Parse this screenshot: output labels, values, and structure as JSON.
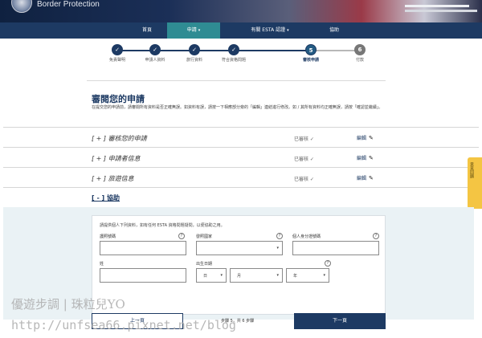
{
  "header": {
    "agency": "Border Protection"
  },
  "nav": {
    "items": [
      {
        "label": "首頁"
      },
      {
        "label": "申請",
        "caret": "▾"
      },
      {
        "label": "有關 ESTA 認證",
        "caret": "▾"
      },
      {
        "label": "協助"
      }
    ]
  },
  "progress": {
    "steps": [
      {
        "marker": "✓",
        "label": "免責聲明"
      },
      {
        "marker": "✓",
        "label": "申請人資料"
      },
      {
        "marker": "✓",
        "label": "旅行資料"
      },
      {
        "marker": "✓",
        "label": "符合資格問題"
      },
      {
        "marker": "5",
        "label": "審核申請"
      },
      {
        "marker": "6",
        "label": "付款"
      }
    ]
  },
  "main": {
    "title": "審閱您的申請",
    "intro": "在提交您的申請前，請審閱所有資料是否正確無誤。如資料有誤，請按一下相應部分旁的「編輯」連結進行修改。如 / 其所有資料均正確無誤，請按「確認並繼續」。"
  },
  "sections": [
    {
      "title": "[ + ] 審核您的申請",
      "status": "已審核 ✓",
      "edit": "編輯",
      "pencil": "✎"
    },
    {
      "title": "[ + ] 申請者信息",
      "status": "已審核 ✓",
      "edit": "編輯",
      "pencil": "✎"
    },
    {
      "title": "[ + ] 旅遊信息",
      "status": "已審核 ✓",
      "edit": "編輯",
      "pencil": "✎"
    }
  ],
  "help": {
    "label": "[ - ] 協助"
  },
  "side_tab": {
    "label": "意見回饋"
  },
  "form": {
    "hint": "請提供個人下列資料，如有任何 ESTA 資格問題疑問，以便協助之用。",
    "qmark": "?",
    "fields": {
      "passport_number": {
        "label": "護照號碼"
      },
      "issuing_country": {
        "label": "發照國家"
      },
      "personal_id": {
        "label": "個人身分證號碼"
      },
      "surname": {
        "label": "姓"
      },
      "dob": {
        "label": "出生日期",
        "day": "日",
        "month": "月",
        "year": "年"
      }
    },
    "dropdown_arrow": "▾"
  },
  "footer": {
    "prev": "上一頁",
    "step_count": "步驟 5，共 6 步驟",
    "next": "下一頁"
  },
  "watermark": {
    "line1": "優遊步調 | 珠粒兒YO",
    "line2": "http://unfsea66.pixnet.net/blog"
  },
  "colors": {
    "navy": "#1d3a63",
    "teal_active": "#2f8c93",
    "help_tab": "#f4c543"
  }
}
